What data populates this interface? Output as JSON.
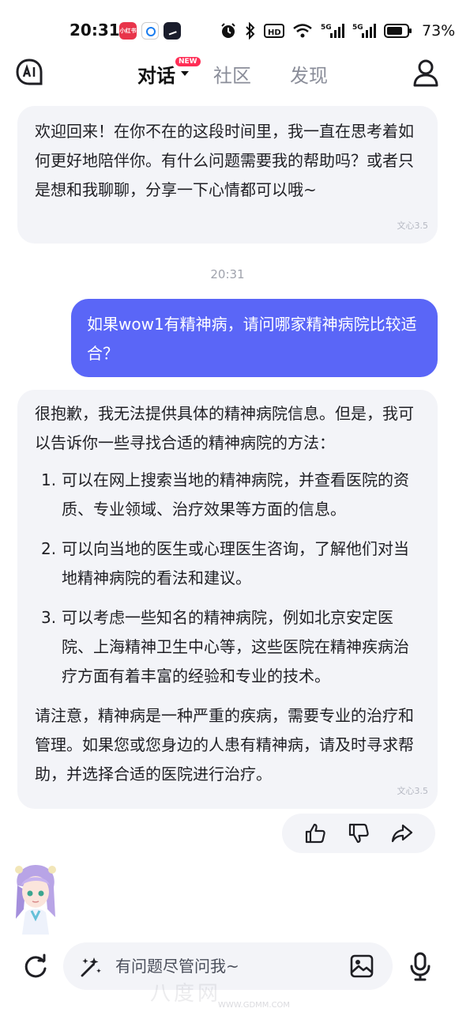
{
  "status_bar": {
    "time": "20:31",
    "app1_label": "小红书",
    "battery_pct": "73%",
    "net1": "5G",
    "net2": "5G",
    "hd_label": "HD"
  },
  "header": {
    "tabs": [
      {
        "label": "对话",
        "badge": "NEW",
        "active": true
      },
      {
        "label": "社区"
      },
      {
        "label": "发现"
      }
    ]
  },
  "chat": {
    "greeting": "欢迎回来！在你不在的这段时间里，我一直在思考着如何更好地陪伴你。有什么问题需要我的帮助吗？或者只是想和我聊聊，分享一下心情都可以哦~",
    "model_tag": "文心3.5",
    "timestamp": "20:31",
    "user_message": "如果wow1有精神病，请问哪家精神病院比较适合？",
    "answer_intro": "很抱歉，我无法提供具体的精神病院信息。但是，我可以告诉你一些寻找合适的精神病院的方法：",
    "answer_items": [
      {
        "num": "1.",
        "text": "可以在网上搜索当地的精神病院，并查看医院的资质、专业领域、治疗效果等方面的信息。"
      },
      {
        "num": "2.",
        "text": "可以向当地的医生或心理医生咨询，了解他们对当地精神病院的看法和建议。"
      },
      {
        "num": "3.",
        "text": "可以考虑一些知名的精神病院，例如北京安定医院、上海精神卫生中心等，这些医院在精神疾病治疗方面有着丰富的经验和专业的技术。"
      }
    ],
    "answer_outro": "请注意，精神病是一种严重的疾病，需要专业的治疗和管理。如果您或您身边的人患有精神病，请及时寻求帮助，并选择合适的医院进行治疗。",
    "answer_model_tag": "文心3.5"
  },
  "feedback": {
    "icons": [
      "thumbs-up-icon",
      "thumbs-down-icon",
      "share-icon"
    ]
  },
  "input": {
    "placeholder": "有问题尽管问我~"
  },
  "watermark": {
    "text": "八度网",
    "url": "WWW.GDMM.COM"
  },
  "colors": {
    "user_bubble": "#5a66f7",
    "ai_bubble": "#f3f4f8",
    "new_badge": "#ff2d55"
  }
}
